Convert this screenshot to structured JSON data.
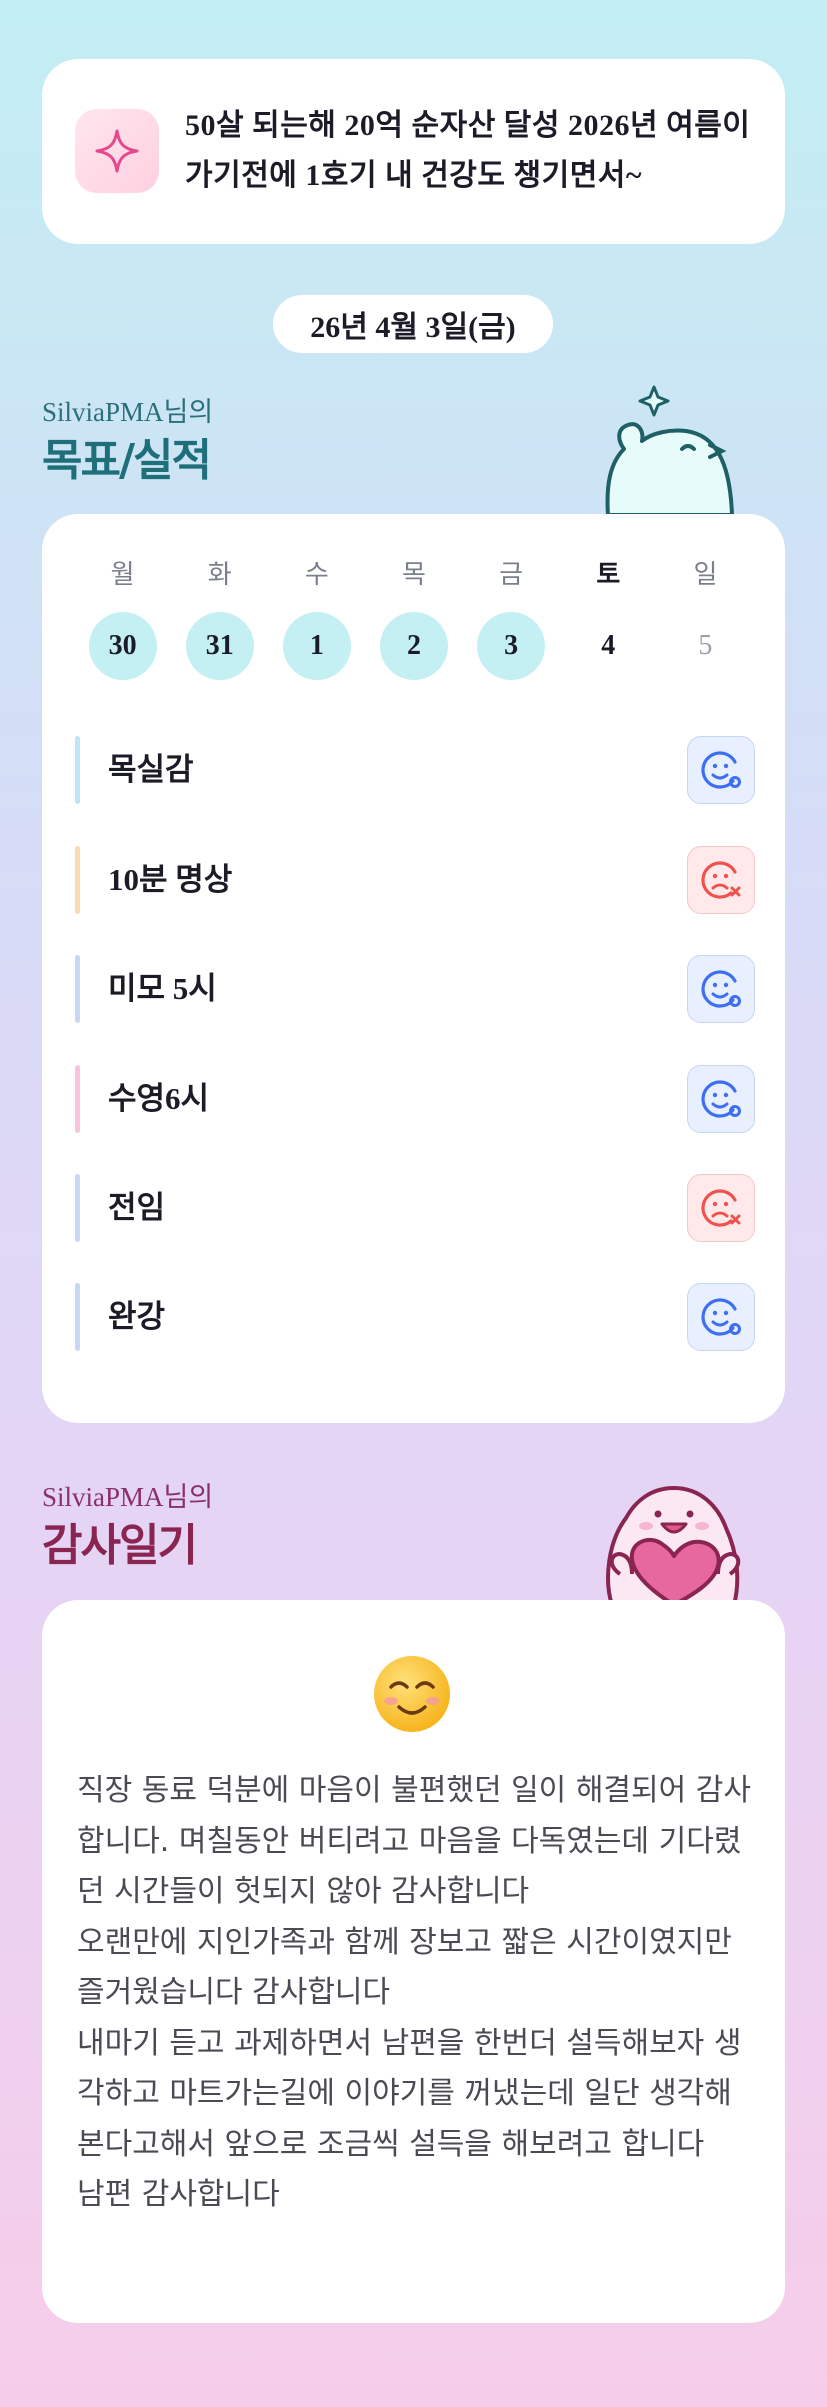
{
  "goal": {
    "icon": "sparkle-icon",
    "text": "50살 되는해 20억 순자산 달성 2026년 여름이 가기전에 1호기 내 건강도 챙기면서~"
  },
  "date_label": "26년 4월 3일(금)",
  "goals_section": {
    "user_label": "SilviaPMA님의",
    "title": "목표/실적"
  },
  "calendar": {
    "weekdays": [
      "월",
      "화",
      "수",
      "목",
      "금",
      "토",
      "일"
    ],
    "dates": [
      "30",
      "31",
      "1",
      "2",
      "3",
      "4",
      "5"
    ]
  },
  "tasks": [
    {
      "label": "목실감",
      "status": "done",
      "bar_color": "#bde5f5"
    },
    {
      "label": "10분 명상",
      "status": "missed",
      "bar_color": "#fbd9b3"
    },
    {
      "label": "미모 5시",
      "status": "done",
      "bar_color": "#c9d7f5"
    },
    {
      "label": "수영6시",
      "status": "done",
      "bar_color": "#f7c6de"
    },
    {
      "label": "전임",
      "status": "missed",
      "bar_color": "#c9d7f5"
    },
    {
      "label": "완강",
      "status": "done",
      "bar_color": "#c9d7f5"
    }
  ],
  "gratitude_section": {
    "user_label": "SilviaPMA님의",
    "title": "감사일기"
  },
  "gratitude": {
    "emoji": "smiling-face-icon",
    "body": "직장 동료 덕분에 마음이 불편했던 일이 해결되어 감사합니다. 며칠동안 버티려고 마음을 다독였는데 기다렸던 시간들이 헛되지 않아 감사합니다\n오랜만에 지인가족과 함께 장보고 짧은 시간이였지만 즐거웠습니다 감사합니다\n내마기 듣고 과제하면서 남편을 한번더 설득해보자 생각하고 마트가는길에 이야기를 꺼냈는데 일단 생각해본다고해서 앞으로 조금씩 설득을 해보려고 합니다\n남편 감사합니다"
  },
  "colors": {
    "accent_teal": "#1f6f7a",
    "accent_plum": "#8a2552",
    "done_blue": "#3d6ff2",
    "missed_red": "#ef5350",
    "today_circle": "#c4f0f3"
  }
}
